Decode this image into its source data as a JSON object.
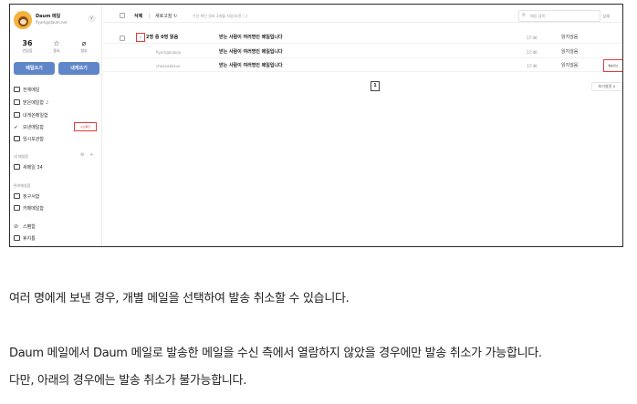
{
  "profile": {
    "name": "Daum 메일",
    "email": "flyark@daum.net",
    "menu": "∨"
  },
  "stats": [
    {
      "value": "36",
      "icon": "",
      "label": "안읽음"
    },
    {
      "value": "",
      "icon": "☆",
      "label": "중요"
    },
    {
      "value": "",
      "icon": "⌀",
      "label": "첨부"
    }
  ],
  "buttons": {
    "write": "메일쓰기",
    "self": "내게쓰기"
  },
  "nav": [
    {
      "label": "전체메일",
      "count": "",
      "icon": "inbox-icon"
    },
    {
      "label": "받은메일함",
      "count": "2",
      "icon": "inbox-icon"
    },
    {
      "label": "내게쓴메일함",
      "count": "",
      "icon": "note-icon"
    },
    {
      "label": "보낸메일함",
      "count": "",
      "icon": "send-icon"
    },
    {
      "label": "임시보관함",
      "count": "",
      "icon": "folder-icon"
    }
  ],
  "sent_cancel_tag": "수신확인",
  "my_section": {
    "title": "내 메일함",
    "acts": "⚙ +",
    "items": [
      {
        "label": "새메일 34",
        "icon": "folder-icon"
      }
    ]
  },
  "service_section": {
    "title": "편리메일함",
    "items": [
      {
        "label": "청구서함",
        "icon": "bill-icon"
      },
      {
        "label": "카페메일함",
        "icon": "folder-icon"
      }
    ]
  },
  "bottom_nav": [
    {
      "label": "스팸함",
      "icon": "block-icon"
    },
    {
      "label": "휴지통",
      "icon": "trash-icon"
    }
  ],
  "toolbar": {
    "delete": "삭제",
    "refresh": "새로고침 ↻",
    "note": "수신 확인 정보 3개월 저장(보관 ⓘ)",
    "search_placeholder": "메일 검색",
    "detail": "상세"
  },
  "mail_rows": [
    {
      "subject": "2명 중 0명 읽음",
      "title": "받는 사람이 여러명인 메일입니다",
      "time": "17:46",
      "status": "읽지않음"
    },
    {
      "subject": "flyark@kakao",
      "title": "받는 사람이 여러명인 메일입니다",
      "time": "17:46",
      "status": "읽지않음"
    },
    {
      "subject": "choanakkave",
      "title": "받는 사람이 여러명인 메일입니다",
      "time": "17:46",
      "status": "읽지않음"
    }
  ],
  "expand_glyph": "∨",
  "cancel_button": "발송취소",
  "pagination": {
    "current": "1"
  },
  "view_settings": "보기설정 ∨",
  "paragraphs": [
    "여러 명에게 보낸 경우, 개별 메일을 선택하여 발송 취소할 수 있습니다.",
    "Daum 메일에서 Daum 메일로 발송한 메일을 수신 측에서 열람하지 않았을 경우에만 발송 취소가 가능합니다.",
    "다만, 아래의 경우에는 발송 취소가 불가능합니다."
  ]
}
